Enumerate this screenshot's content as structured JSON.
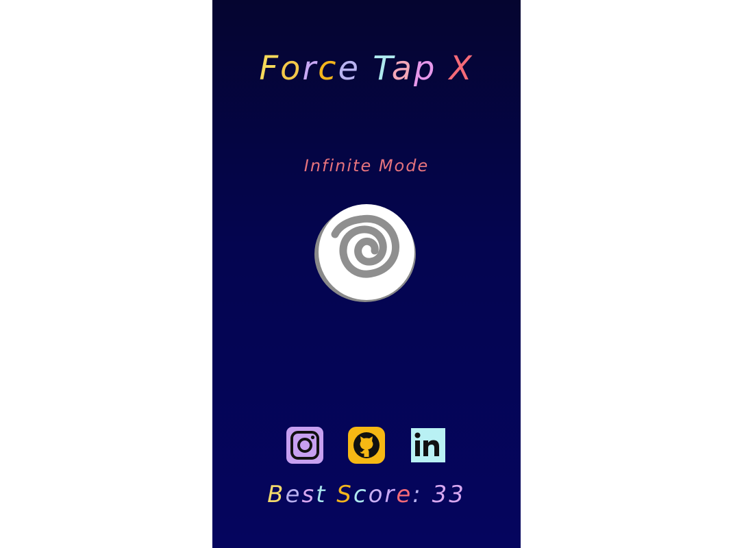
{
  "title": {
    "letters": [
      {
        "char": "F",
        "color": "#f6d95a"
      },
      {
        "char": "o",
        "color": "#f4c84a"
      },
      {
        "char": "r",
        "color": "#c8a8f4"
      },
      {
        "char": "c",
        "color": "#f4b51c"
      },
      {
        "char": "e",
        "color": "#b9b3f1"
      },
      {
        "char": " ",
        "color": "#ffffff"
      },
      {
        "char": "T",
        "color": "#aee8ee"
      },
      {
        "char": "a",
        "color": "#f3a7b8"
      },
      {
        "char": "p",
        "color": "#e698ea"
      },
      {
        "char": " ",
        "color": "#ffffff"
      },
      {
        "char": "X",
        "color": "#f46a78"
      }
    ]
  },
  "mode_label": "Infinite Mode",
  "tap_button": {
    "icon": "spiral-icon",
    "fill": "#ffffff",
    "shadow": "#8a8a8a"
  },
  "socials": [
    {
      "name": "instagram-icon",
      "color": "#c7a0f1"
    },
    {
      "name": "github-icon",
      "color": "#f6b814"
    },
    {
      "name": "linkedin-icon",
      "color": "#b9f1f4"
    }
  ],
  "best_score": {
    "letters": [
      {
        "char": "B",
        "color": "#f3d96b"
      },
      {
        "char": "e",
        "color": "#b8b0f0"
      },
      {
        "char": "s",
        "color": "#d8a8f0"
      },
      {
        "char": "t",
        "color": "#a9e4ec"
      },
      {
        "char": " ",
        "color": "#ffffff"
      },
      {
        "char": "S",
        "color": "#f4b51c"
      },
      {
        "char": "c",
        "color": "#aee8ee"
      },
      {
        "char": "o",
        "color": "#c9b0f4"
      },
      {
        "char": "r",
        "color": "#c8a8f4"
      },
      {
        "char": "e",
        "color": "#f46a78"
      },
      {
        "char": ":",
        "color": "#b9b3f1"
      },
      {
        "char": " ",
        "color": "#ffffff"
      },
      {
        "char": "3",
        "color": "#d8a8f0"
      },
      {
        "char": "3",
        "color": "#d8a8f0"
      }
    ]
  }
}
